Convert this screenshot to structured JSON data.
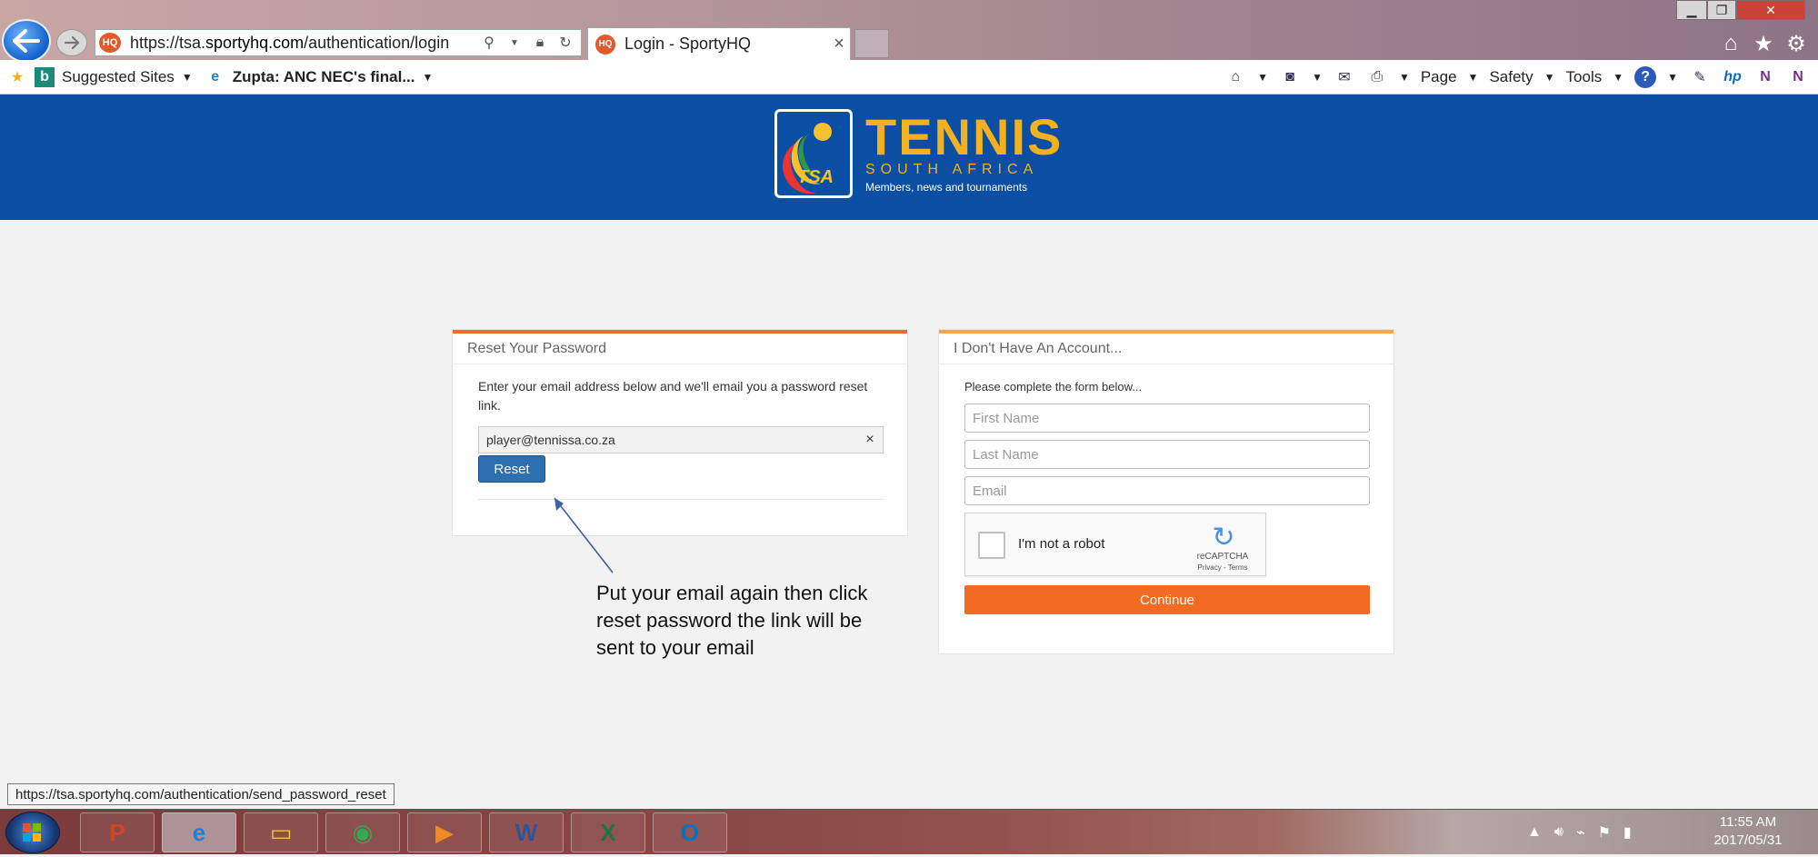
{
  "browser": {
    "url_prefix": "https://tsa.",
    "url_host": "sportyhq.com",
    "url_path": "/authentication/login",
    "favicon_label": "HQ",
    "tab_title": "Login - SportyHQ",
    "tab_close": "×",
    "window_min": "▁",
    "window_max": "❐",
    "window_close": "✕"
  },
  "favorites": [
    {
      "label": "Suggested Sites",
      "icon": "bing-icon"
    },
    {
      "label": "Zupta: ANC NEC's final...",
      "icon": "ie-page-icon"
    }
  ],
  "command_bar": {
    "page": "Page",
    "safety": "Safety",
    "tools": "Tools"
  },
  "site": {
    "logo_title": "TENNIS",
    "logo_subtitle": "SOUTH AFRICA",
    "logo_tagline": "Members, news and tournaments",
    "logo_mark": "TSA"
  },
  "reset_panel": {
    "heading": "Reset Your Password",
    "intro": "Enter your email address below and we'll email you a password reset link.",
    "email_value": "player@tennissa.co.za",
    "clear": "×",
    "button": "Reset"
  },
  "signup_panel": {
    "heading": "I Don't Have An Account...",
    "intro": "Please complete the form below...",
    "first_name_placeholder": "First Name",
    "last_name_placeholder": "Last Name",
    "email_placeholder": "Email",
    "captcha_label": "I'm not a robot",
    "captcha_brand": "reCAPTCHA",
    "captcha_terms": "Privacy - Terms",
    "button": "Continue"
  },
  "annotation": "Put your email again  then click reset password the link will be sent to your email",
  "status_url": "https://tsa.sportyhq.com/authentication/send_password_reset",
  "taskbar": {
    "apps": [
      {
        "name": "powerpoint",
        "glyph": "P",
        "color": "#d24726"
      },
      {
        "name": "internet-explorer",
        "glyph": "e",
        "color": "#1e7fd6"
      },
      {
        "name": "file-explorer",
        "glyph": "▭",
        "color": "#f0c24b"
      },
      {
        "name": "chrome",
        "glyph": "◉",
        "color": "#34a853"
      },
      {
        "name": "media-player",
        "glyph": "▶",
        "color": "#f08a24"
      },
      {
        "name": "word",
        "glyph": "W",
        "color": "#2b579a"
      },
      {
        "name": "excel",
        "glyph": "X",
        "color": "#217346"
      },
      {
        "name": "outlook",
        "glyph": "O",
        "color": "#0072c6"
      }
    ],
    "time": "11:55 AM",
    "date": "2017/05/31"
  }
}
